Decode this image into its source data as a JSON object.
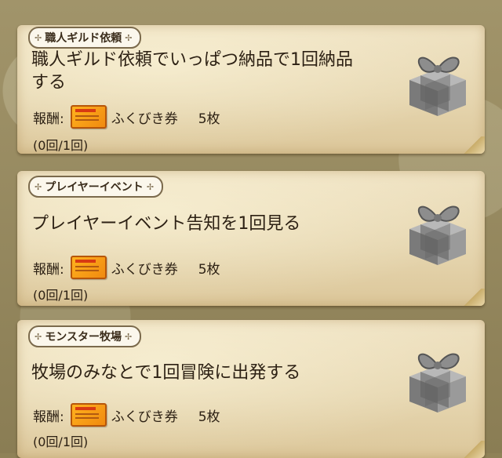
{
  "missions": [
    {
      "category": "職人ギルド依頼",
      "title_lines": [
        "職人ギルド依頼でいっぱつ納品で1回納品",
        "する"
      ],
      "reward_label": "報酬:",
      "reward_item": "ふくびき券",
      "reward_count": "5枚",
      "progress": "(0回/1回)",
      "icons": {
        "tag": "tag-ornament-icon",
        "reward": "fukubiki-ticket-icon",
        "gift": "gift-box-icon"
      }
    },
    {
      "category": "プレイヤーイベント",
      "title_lines": [
        "プレイヤーイベント告知を1回見る"
      ],
      "reward_label": "報酬:",
      "reward_item": "ふくびき券",
      "reward_count": "5枚",
      "progress": "(0回/1回)",
      "icons": {
        "tag": "tag-ornament-icon",
        "reward": "fukubiki-ticket-icon",
        "gift": "gift-box-icon"
      }
    },
    {
      "category": "モンスター牧場",
      "title_lines": [
        "牧場のみなとで1回冒険に出発する"
      ],
      "reward_label": "報酬:",
      "reward_item": "ふくびき券",
      "reward_count": "5枚",
      "progress": "(0回/1回)",
      "icons": {
        "tag": "tag-ornament-icon",
        "reward": "fukubiki-ticket-icon",
        "gift": "gift-box-icon"
      }
    }
  ],
  "colors": {
    "parchment": "#e8d9b4",
    "text": "#2d2114",
    "ticket": "#f29a12",
    "tag_border": "#7b6a4c",
    "gift": "#8a8a8a"
  }
}
